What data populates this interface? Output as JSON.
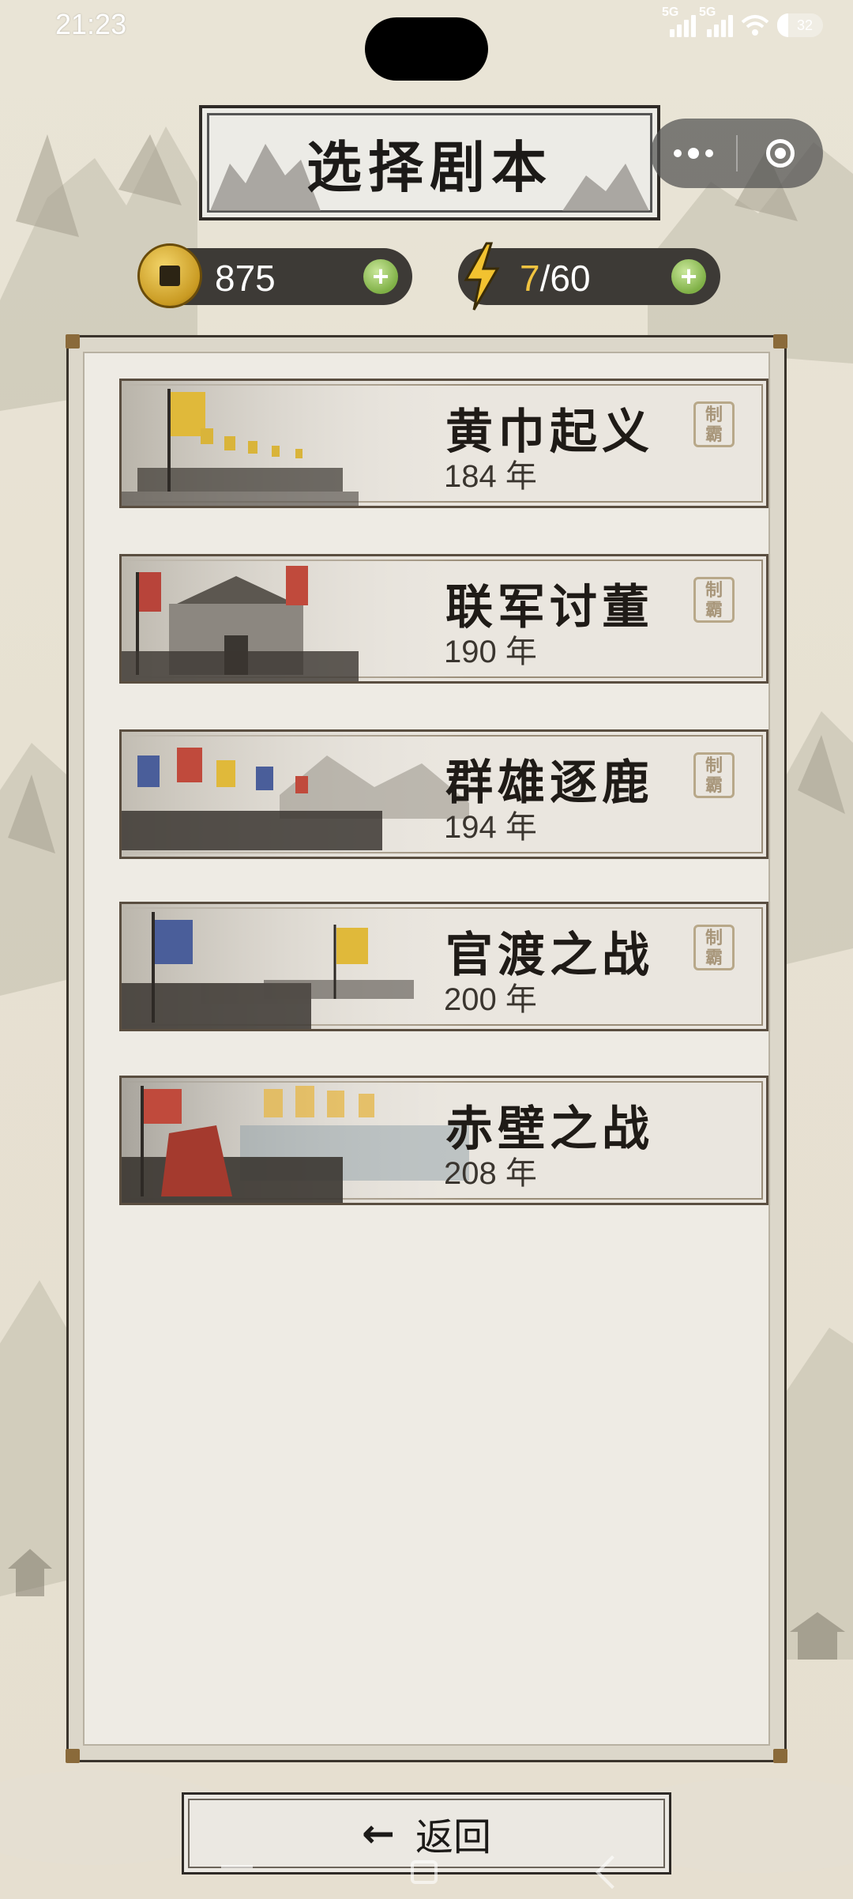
{
  "status_bar": {
    "time": "21:23",
    "signal1_label": "5G",
    "signal2_label": "5G",
    "battery": "32"
  },
  "header": {
    "title": "选择剧本"
  },
  "capsule": {
    "more_icon": "more-dots-icon",
    "close_icon": "target-close-icon"
  },
  "resources": {
    "coins": "875",
    "energy_current": "7",
    "energy_max": "/60"
  },
  "scenarios": [
    {
      "name": "黄巾起义",
      "year": "184 年",
      "seal": "制霸"
    },
    {
      "name": "联军讨董",
      "year": "190 年",
      "seal": "制霸"
    },
    {
      "name": "群雄逐鹿",
      "year": "194 年",
      "seal": "制霸"
    },
    {
      "name": "官渡之战",
      "year": "200 年",
      "seal": "制霸"
    },
    {
      "name": "赤壁之战",
      "year": "208 年",
      "seal": ""
    }
  ],
  "footer": {
    "back_label": "返回"
  },
  "colors": {
    "pill_bg": "#3d3a36",
    "energy_accent": "#f0c340",
    "plus_green": "#7fb046",
    "frame_dark": "#2e2a26"
  }
}
